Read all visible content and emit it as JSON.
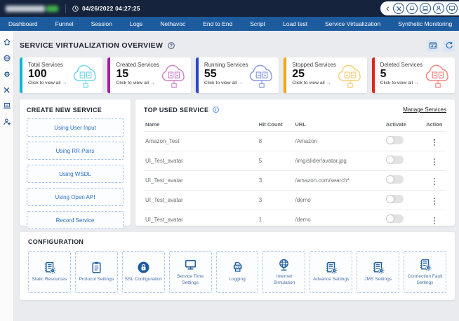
{
  "topbar": {
    "datetime": "04/26/2022 04:27:25",
    "icons": [
      "chevron-left-icon",
      "tools-icon",
      "bell-icon",
      "laptop-icon",
      "user-icon",
      "monitor-icon"
    ]
  },
  "nav": {
    "items": [
      "Dashboard",
      "Funnel",
      "Session",
      "Logs",
      "Nethavoc",
      "End to End",
      "Script",
      "Load test",
      "Service Virtualization",
      "Synthetic Monitoring"
    ]
  },
  "sidebar": {
    "icons": [
      "home-icon",
      "globe-icon",
      "gear-icon",
      "tools-icon",
      "laptop-chart-icon",
      "user-add-icon"
    ]
  },
  "header": {
    "title": "SERVICE VIRTUALIZATION OVERVIEW",
    "actions": [
      "report-window-icon",
      "refresh-icon"
    ]
  },
  "stats": {
    "link_label": "Click to view all →",
    "cards": [
      {
        "label": "Total Services",
        "value": "100",
        "accent": "#00b7d6"
      },
      {
        "label": "Created Services",
        "value": "15",
        "accent": "#a71fa0"
      },
      {
        "label": "Running Services",
        "value": "55",
        "accent": "#2b46c8"
      },
      {
        "label": "Stopped Services",
        "value": "25",
        "accent": "#f6a609"
      },
      {
        "label": "Deleted Services",
        "value": "5",
        "accent": "#e2231a"
      }
    ]
  },
  "create_service": {
    "title": "CREATE NEW SERVICE",
    "buttons": [
      "Using User Input",
      "Using RR Pairs",
      "Using WSDL",
      "Using Open API",
      "Record Service"
    ]
  },
  "top_used": {
    "title": "TOP USED SERVICE",
    "manage_link": "Manage Services",
    "columns": {
      "name": "Name",
      "hits": "Hit Count",
      "url": "URL",
      "activate": "Activate",
      "action": "Action"
    },
    "rows": [
      {
        "name": "Amazon_Test",
        "hits": "8",
        "url": "/Amazon",
        "activate": false
      },
      {
        "name": "UI_Test_avatar",
        "hits": "5",
        "url": "/img/slider/avatar.jpg",
        "activate": false
      },
      {
        "name": "UI_Test_avatar",
        "hits": "3",
        "url": "/amazon.com/search*",
        "activate": false
      },
      {
        "name": "UI_Test_avatar",
        "hits": "3",
        "url": "/demo",
        "activate": false
      },
      {
        "name": "UI_Test_avatar",
        "hits": "1",
        "url": "/demo",
        "activate": false
      }
    ]
  },
  "configuration": {
    "title": "CONFIGURATION",
    "tiles": [
      {
        "label": "Static Resources",
        "icon": "doc-gear-icon"
      },
      {
        "label": "Protocol Settings",
        "icon": "clipboard-icon"
      },
      {
        "label": "SSL Configuration",
        "icon": "lock-icon"
      },
      {
        "label": "Service Time Settings",
        "icon": "monitor-icon"
      },
      {
        "label": "Logging",
        "icon": "log-printer-icon"
      },
      {
        "label": "Internet Simulation",
        "icon": "internet-globe-icon"
      },
      {
        "label": "Advance Settings",
        "icon": "doc-gear-icon"
      },
      {
        "label": "JMS Settings",
        "icon": "doc-gear-icon"
      },
      {
        "label": "Connection Fault Settings",
        "icon": "doc-gear-icon"
      }
    ]
  }
}
